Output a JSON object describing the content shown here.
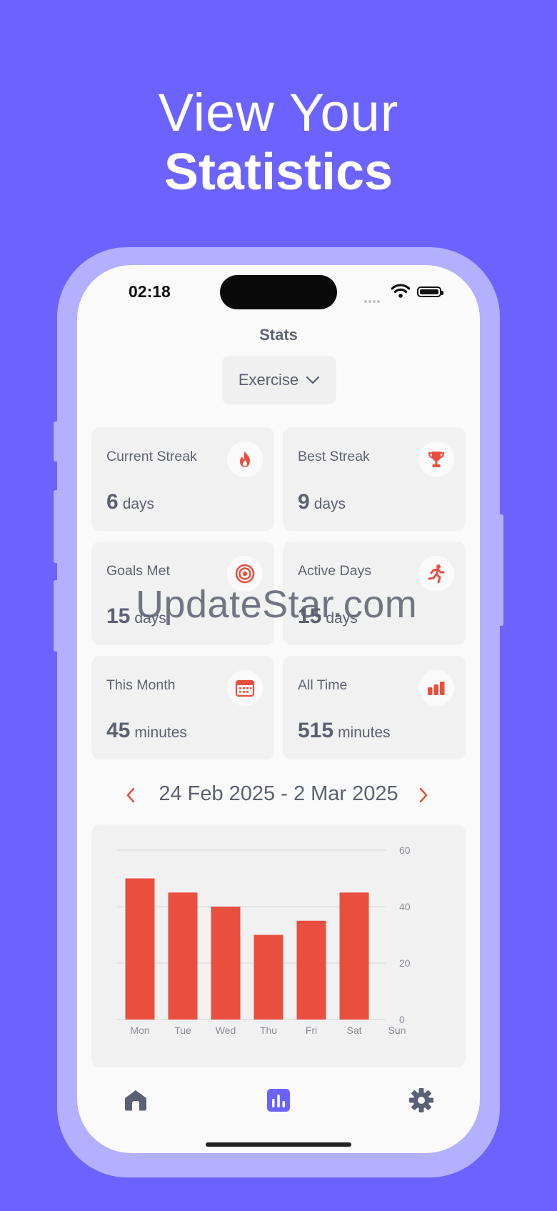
{
  "headline": {
    "line1": "View Your",
    "line2": "Statistics"
  },
  "status_bar": {
    "time": "02:18"
  },
  "header": {
    "title": "Stats"
  },
  "category_select": {
    "selected": "Exercise"
  },
  "stats_cards": [
    {
      "label": "Current Streak",
      "value": "6",
      "unit": "days",
      "icon": "flame-icon"
    },
    {
      "label": "Best Streak",
      "value": "9",
      "unit": "days",
      "icon": "trophy-icon"
    },
    {
      "label": "Goals Met",
      "value": "15",
      "unit": "days",
      "icon": "target-icon"
    },
    {
      "label": "Active Days",
      "value": "15",
      "unit": "days",
      "icon": "running-icon"
    },
    {
      "label": "This Month",
      "value": "45",
      "unit": "minutes",
      "icon": "calendar-icon"
    },
    {
      "label": "All Time",
      "value": "515",
      "unit": "minutes",
      "icon": "bar-chart-icon"
    }
  ],
  "date_range": {
    "label": "24 Feb 2025 - 2 Mar 2025"
  },
  "chart_data": {
    "type": "bar",
    "categories": [
      "Mon",
      "Tue",
      "Wed",
      "Thu",
      "Fri",
      "Sat",
      "Sun"
    ],
    "values": [
      50,
      45,
      40,
      30,
      35,
      45,
      0
    ],
    "title": "",
    "xlabel": "",
    "ylabel": "",
    "ylim": [
      0,
      60
    ],
    "yticks": [
      0,
      20,
      40,
      60
    ],
    "grid": true,
    "bar_color": "#e84f3f"
  },
  "tabbar": {
    "items": [
      "home-icon",
      "stats-icon",
      "settings-icon"
    ],
    "active": "stats-icon"
  },
  "watermark": "UpdateStar.com",
  "colors": {
    "background": "#6c63ff",
    "accent": "#e84f3f",
    "active_tab": "#6c63ff",
    "frame": "#b3b0ff"
  }
}
